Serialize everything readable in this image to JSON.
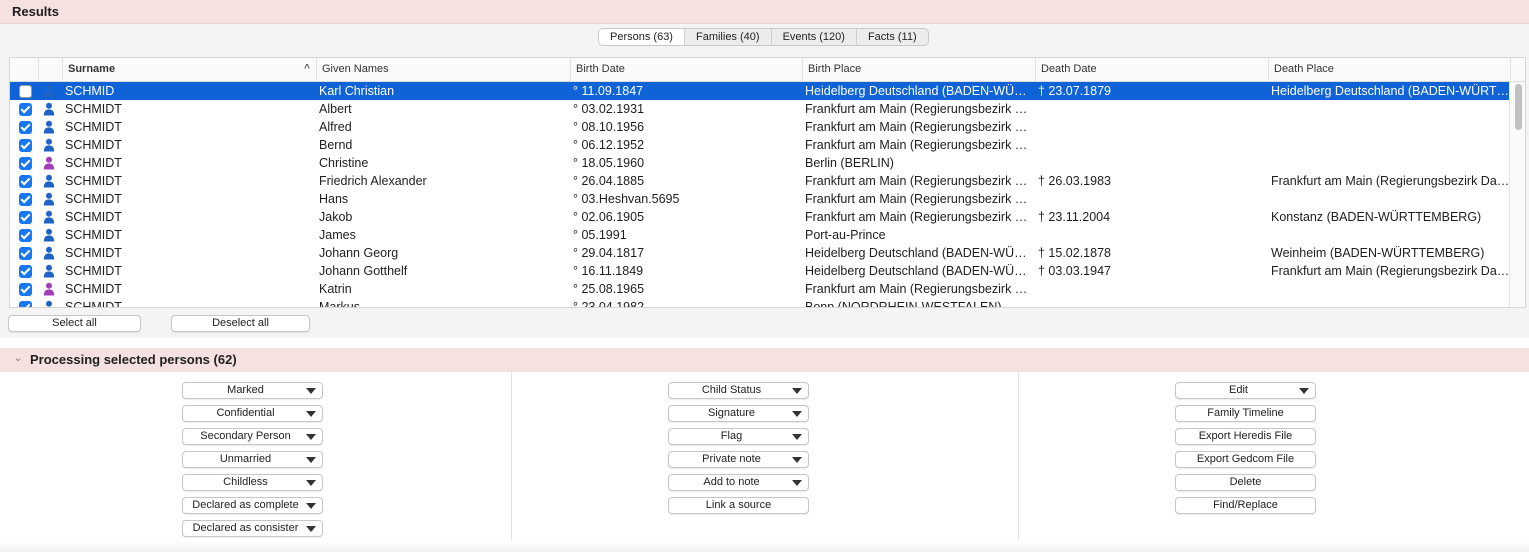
{
  "results": {
    "title": "Results",
    "tabs": [
      {
        "label": "Persons (63)",
        "active": true
      },
      {
        "label": "Families (40)",
        "active": false
      },
      {
        "label": "Events (120)",
        "active": false
      },
      {
        "label": "Facts (11)",
        "active": false
      }
    ],
    "columns": {
      "surname": "Surname",
      "given_names": "Given Names",
      "birth_date": "Birth Date",
      "birth_place": "Birth Place",
      "death_date": "Death Date",
      "death_place": "Death Place"
    },
    "sort_indicator": "^",
    "rows": [
      {
        "checked": false,
        "selected": true,
        "gender": "male",
        "surname": "SCHMID",
        "given": "Karl Christian",
        "birth_date": "° 11.09.1847",
        "birth_place": "Heidelberg Deutschland (BADEN-WÜRTTEMBERG)",
        "death_date": "† 23.07.1879",
        "death_place": "Heidelberg Deutschland (BADEN-WÜRTTEMBERG)"
      },
      {
        "checked": true,
        "selected": false,
        "gender": "male",
        "surname": "SCHMIDT",
        "given": "Albert",
        "birth_date": "° 03.02.1931",
        "birth_place": "Frankfurt am Main (Regierungsbezirk Darmstadt)",
        "death_date": "",
        "death_place": ""
      },
      {
        "checked": true,
        "selected": false,
        "gender": "male",
        "surname": "SCHMIDT",
        "given": "Alfred",
        "birth_date": "° 08.10.1956",
        "birth_place": "Frankfurt am Main (Regierungsbezirk Darmstadt)",
        "death_date": "",
        "death_place": ""
      },
      {
        "checked": true,
        "selected": false,
        "gender": "male",
        "surname": "SCHMIDT",
        "given": "Bernd",
        "birth_date": "° 06.12.1952",
        "birth_place": "Frankfurt am Main (Regierungsbezirk Darmstadt)",
        "death_date": "",
        "death_place": ""
      },
      {
        "checked": true,
        "selected": false,
        "gender": "female",
        "surname": "SCHMIDT",
        "given": "Christine",
        "birth_date": "° 18.05.1960",
        "birth_place": "Berlin (BERLIN)",
        "death_date": "",
        "death_place": ""
      },
      {
        "checked": true,
        "selected": false,
        "gender": "male",
        "surname": "SCHMIDT",
        "given": "Friedrich Alexander",
        "birth_date": "° 26.04.1885",
        "birth_place": "Frankfurt am Main (Regierungsbezirk Darmstadt)",
        "death_date": "† 26.03.1983",
        "death_place": "Frankfurt am Main (Regierungsbezirk Darmstadt)"
      },
      {
        "checked": true,
        "selected": false,
        "gender": "male",
        "surname": "SCHMIDT",
        "given": "Hans",
        "birth_date": "° 03.Heshvan.5695",
        "birth_place": "Frankfurt am Main (Regierungsbezirk Darmstadt)",
        "death_date": "",
        "death_place": ""
      },
      {
        "checked": true,
        "selected": false,
        "gender": "male",
        "surname": "SCHMIDT",
        "given": "Jakob",
        "birth_date": "° 02.06.1905",
        "birth_place": "Frankfurt am Main (Regierungsbezirk Darmstadt)",
        "death_date": "† 23.11.2004",
        "death_place": "Konstanz (BADEN-WÜRTTEMBERG)"
      },
      {
        "checked": true,
        "selected": false,
        "gender": "male",
        "surname": "SCHMIDT",
        "given": "James",
        "birth_date": "° 05.1991",
        "birth_place": "Port-au-Prince",
        "death_date": "",
        "death_place": ""
      },
      {
        "checked": true,
        "selected": false,
        "gender": "male",
        "surname": "SCHMIDT",
        "given": "Johann Georg",
        "birth_date": "° 29.04.1817",
        "birth_place": "Heidelberg Deutschland (BADEN-WÜRTTEMBERG)",
        "death_date": "† 15.02.1878",
        "death_place": "Weinheim (BADEN-WÜRTTEMBERG)"
      },
      {
        "checked": true,
        "selected": false,
        "gender": "male",
        "surname": "SCHMIDT",
        "given": "Johann Gotthelf",
        "birth_date": "° 16.11.1849",
        "birth_place": "Heidelberg Deutschland (BADEN-WÜRTTEMBERG)",
        "death_date": "† 03.03.1947",
        "death_place": "Frankfurt am Main (Regierungsbezirk Darmstadt)"
      },
      {
        "checked": true,
        "selected": false,
        "gender": "female",
        "surname": "SCHMIDT",
        "given": "Katrin",
        "birth_date": "° 25.08.1965",
        "birth_place": "Frankfurt am Main (Regierungsbezirk Darmstadt)",
        "death_date": "",
        "death_place": ""
      },
      {
        "checked": true,
        "selected": false,
        "gender": "male",
        "surname": "SCHMIDT",
        "given": "Markus",
        "birth_date": "° 23.04.1982",
        "birth_place": "Bonn (NORDRHEIN-WESTFALEN)",
        "death_date": "",
        "death_place": ""
      }
    ],
    "select_all": "Select all",
    "deselect_all": "Deselect all"
  },
  "processing": {
    "title": "Processing selected persons (62)",
    "col1": [
      {
        "label": "Marked",
        "dropdown": true
      },
      {
        "label": "Confidential",
        "dropdown": true
      },
      {
        "label": "Secondary Person",
        "dropdown": true
      },
      {
        "label": "Unmarried",
        "dropdown": true
      },
      {
        "label": "Childless",
        "dropdown": true
      },
      {
        "label": "Declared as complete",
        "dropdown": true
      },
      {
        "label": "Declared as consister",
        "dropdown": true
      }
    ],
    "col2": [
      {
        "label": "Child Status",
        "dropdown": true
      },
      {
        "label": "Signature",
        "dropdown": true
      },
      {
        "label": "Flag",
        "dropdown": true
      },
      {
        "label": "Private note",
        "dropdown": true
      },
      {
        "label": "Add to note",
        "dropdown": true
      },
      {
        "label": "Link a source",
        "dropdown": false
      }
    ],
    "col3": [
      {
        "label": "Edit",
        "dropdown": true
      },
      {
        "label": "Family Timeline",
        "dropdown": false
      },
      {
        "label": "Export Heredis File",
        "dropdown": false
      },
      {
        "label": "Export Gedcom File",
        "dropdown": false
      },
      {
        "label": "Delete",
        "dropdown": false
      },
      {
        "label": "Find/Replace",
        "dropdown": false
      }
    ]
  },
  "colors": {
    "header_bg": "#f6e1e1",
    "selection": "#0f63d6",
    "checkbox": "#1877f2",
    "male_icon": "#1f63c5",
    "female_icon": "#a13fb8"
  }
}
